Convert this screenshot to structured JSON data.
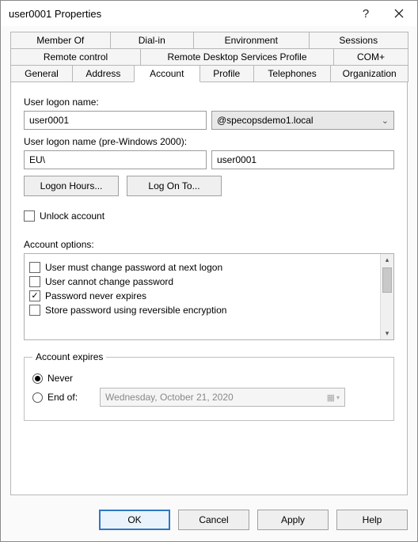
{
  "title": "user0001 Properties",
  "tabs": {
    "row1": [
      "Member Of",
      "Dial-in",
      "Environment",
      "Sessions"
    ],
    "row2": [
      "Remote control",
      "Remote Desktop Services Profile",
      "COM+"
    ],
    "row3": [
      "General",
      "Address",
      "Account",
      "Profile",
      "Telephones",
      "Organization"
    ]
  },
  "active_tab": "Account",
  "account": {
    "logon_label": "User logon name:",
    "logon_value": "user0001",
    "domain_value": "@specopsdemo1.local",
    "prewin_label": "User logon name (pre-Windows 2000):",
    "prewin_domain": "EU\\",
    "prewin_user": "user0001",
    "logon_hours_btn": "Logon Hours...",
    "logon_to_btn": "Log On To...",
    "unlock_label": "Unlock account",
    "unlock_checked": false,
    "options_label": "Account options:",
    "options": [
      {
        "label": "User must change password at next logon",
        "checked": false
      },
      {
        "label": "User cannot change password",
        "checked": false
      },
      {
        "label": "Password never expires",
        "checked": true
      },
      {
        "label": "Store password using reversible encryption",
        "checked": false
      }
    ],
    "expires_legend": "Account expires",
    "never_label": "Never",
    "endof_label": "End of:",
    "endof_date": "Wednesday,   October   21, 2020",
    "expires_selected": "never"
  },
  "footer": {
    "ok": "OK",
    "cancel": "Cancel",
    "apply": "Apply",
    "help": "Help"
  }
}
